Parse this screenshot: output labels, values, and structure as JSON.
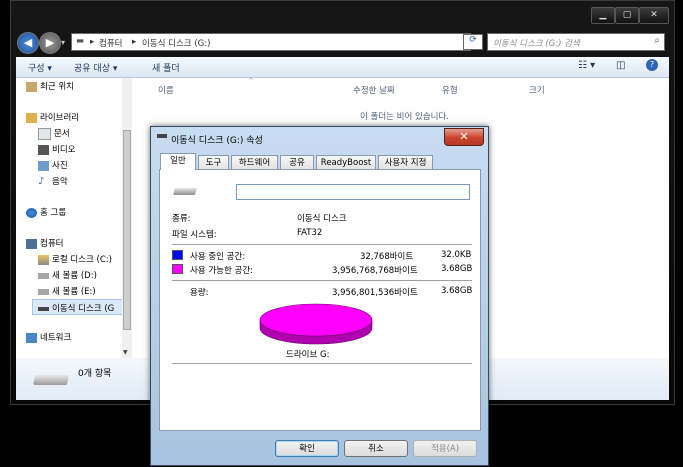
{
  "explorer": {
    "address": {
      "computer": "컴퓨터",
      "drive": "이동식 디스크 (G:)"
    },
    "search_placeholder": "이동식 디스크 (G:) 검색",
    "toolbar": {
      "organize": "구성",
      "share_with": "공유 대상",
      "new_folder": "새 폴더"
    },
    "nav": {
      "recent": "최근 위치",
      "libraries": "라이브러리",
      "documents": "문서",
      "videos": "비디오",
      "pictures": "사진",
      "music": "음악",
      "homegroup": "홈 그룹",
      "computer": "컴퓨터",
      "local_c": "로컬 디스크 (C:)",
      "vol_d": "새 볼륨 (D:)",
      "vol_e": "새 볼륨 (E:)",
      "removable_g": "이동식 디스크 (G",
      "network": "네트워크"
    },
    "columns": {
      "name": "이름",
      "modified": "수정한 날짜",
      "type": "유형",
      "size": "크기"
    },
    "empty_message": "이 폴더는 비어 있습니다.",
    "status_count": "0개 항목"
  },
  "dialog": {
    "title": "이동식 디스크 (G:) 속성",
    "tabs": [
      "일반",
      "도구",
      "하드웨어",
      "공유",
      "ReadyBoost",
      "사용자 지정"
    ],
    "type_label": "종류:",
    "type_value": "이동식 디스크",
    "fs_label": "파일 시스템:",
    "fs_value": "FAT32",
    "used_label": "사용 중인 공간:",
    "used_bytes": "32,768바이트",
    "used_size": "32.0KB",
    "free_label": "사용 가능한 공간:",
    "free_bytes": "3,956,768,768바이트",
    "free_size": "3.68GB",
    "capacity_label": "용량:",
    "capacity_bytes": "3,956,801,536바이트",
    "capacity_size": "3.68GB",
    "drive_label": "드라이브 G:",
    "buttons": {
      "ok": "확인",
      "cancel": "취소",
      "apply": "적용(A)"
    },
    "colors": {
      "used": "#0000ff",
      "free": "#ff00ff"
    },
    "used_fraction": 8.3e-06
  }
}
